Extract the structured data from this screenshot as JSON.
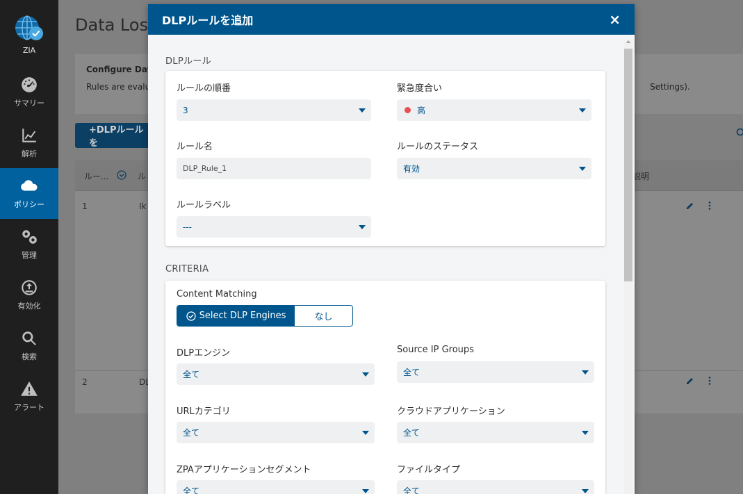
{
  "sidebar": {
    "logo_label": "ZIA",
    "items": [
      {
        "label": "サマリー",
        "icon": "gauge-icon",
        "active": false
      },
      {
        "label": "解析",
        "icon": "chart-icon",
        "active": false
      },
      {
        "label": "ポリシー",
        "icon": "cloud-icon",
        "active": true
      },
      {
        "label": "管理",
        "icon": "gears-icon",
        "active": false
      },
      {
        "label": "有効化",
        "icon": "upload-icon",
        "active": false
      },
      {
        "label": "検索",
        "icon": "search-icon",
        "active": false
      },
      {
        "label": "アラート",
        "icon": "warning-icon",
        "active": false
      }
    ]
  },
  "page": {
    "title": "Data Loss",
    "info_title": "Configure Dat",
    "info_text": "Rules are evalu",
    "info_tail": "Settings).",
    "add_button": "+DLPルールを",
    "columns": {
      "order": "ルー...",
      "name": "ル",
      "description": "説明"
    },
    "rows": [
      {
        "num": "1",
        "name": "Ik"
      },
      {
        "num": "2",
        "name": "DL"
      }
    ]
  },
  "modal": {
    "title": "DLPルールを追加",
    "close": "×",
    "section_rule": "DLPルール",
    "rule_order_label": "ルールの順番",
    "rule_order_value": "3",
    "severity_label": "緊急度合い",
    "severity_value": "高",
    "rule_name_label": "ルール名",
    "rule_name_value": "DLP_Rule_1",
    "rule_status_label": "ルールのステータス",
    "rule_status_value": "有効",
    "rule_label_label": "ルールラベル",
    "rule_label_value": "---",
    "section_criteria": "CRITERIA",
    "content_matching_label": "Content Matching",
    "seg_on": "Select DLP Engines",
    "seg_off": "なし",
    "dlp_engine_label": "DLPエンジン",
    "dlp_engine_value": "全て",
    "source_ip_label": "Source IP Groups",
    "source_ip_value": "全て",
    "url_category_label": "URLカテゴリ",
    "url_category_value": "全て",
    "cloud_app_label": "クラウドアプリケーション",
    "cloud_app_value": "全て",
    "zpa_label": "ZPAアプリケーションセグメント",
    "zpa_value": "全て",
    "file_type_label": "ファイルタイプ",
    "file_type_value": "全て"
  },
  "colors": {
    "brand": "#00558c",
    "severity_high": "#e94f4f",
    "nav_bg": "#1f1f1f"
  }
}
